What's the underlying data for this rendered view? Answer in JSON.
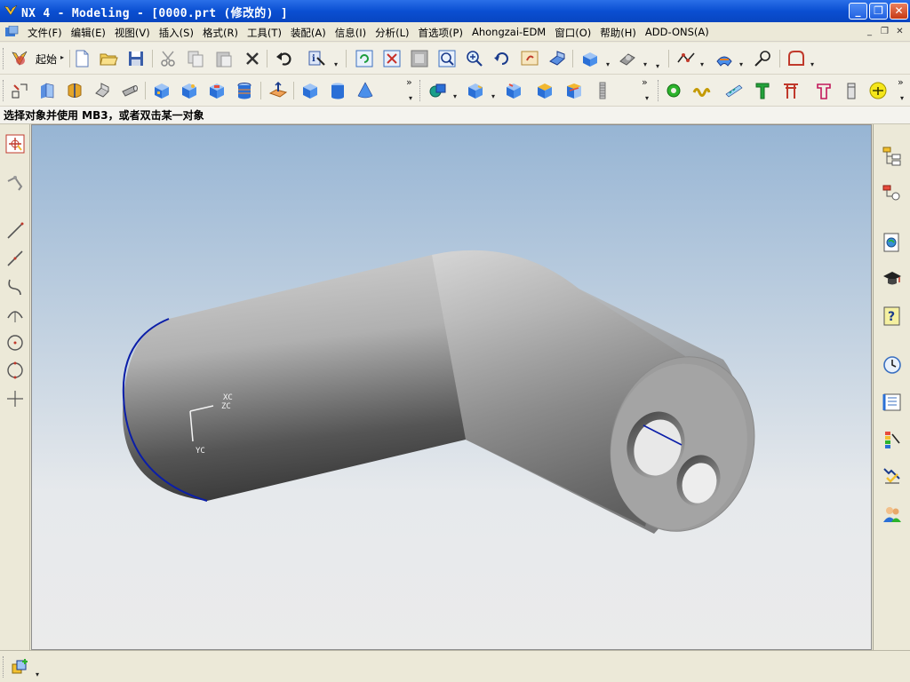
{
  "window": {
    "title": "NX 4 - Modeling - [0000.prt  (修改的) ]",
    "buttons": {
      "minimize": "_",
      "restore": "❐",
      "close": "✕"
    }
  },
  "menu": {
    "items": [
      "文件(F)",
      "编辑(E)",
      "视图(V)",
      "插入(S)",
      "格式(R)",
      "工具(T)",
      "装配(A)",
      "信息(I)",
      "分析(L)",
      "首选项(P)",
      "Ahongzai-EDM",
      "窗口(O)",
      "帮助(H)",
      "ADD-ONS(A)"
    ],
    "mdi_buttons": [
      "_",
      "❐",
      "✕"
    ]
  },
  "toolbar": {
    "start_label": "起始",
    "overflow": "»"
  },
  "prompt": {
    "text": "选择对象并使用 MB3，或者双击某一对象"
  },
  "viewport": {
    "triad": {
      "x_label": "XC",
      "z_label": "ZC",
      "y_label": "YC"
    },
    "colors": {
      "background_top": "#97b5d4",
      "background_bottom": "#ebebeb",
      "edge_highlight": "#0b1ea8"
    }
  },
  "icons": {
    "left_palette": [
      "select-icon",
      "snap-icon",
      "line-icon",
      "line-icon",
      "arc-icon",
      "arc-center-icon",
      "point-icon",
      "circle-icon",
      "cross-icon"
    ],
    "right_resource": [
      "assembly-navigator-icon",
      "part-navigator-icon",
      "web-browser-icon",
      "training-icon",
      "help-icon",
      "history-icon",
      "system-materials-icon",
      "roles-icon",
      "palette-icon",
      "user-icon"
    ]
  }
}
